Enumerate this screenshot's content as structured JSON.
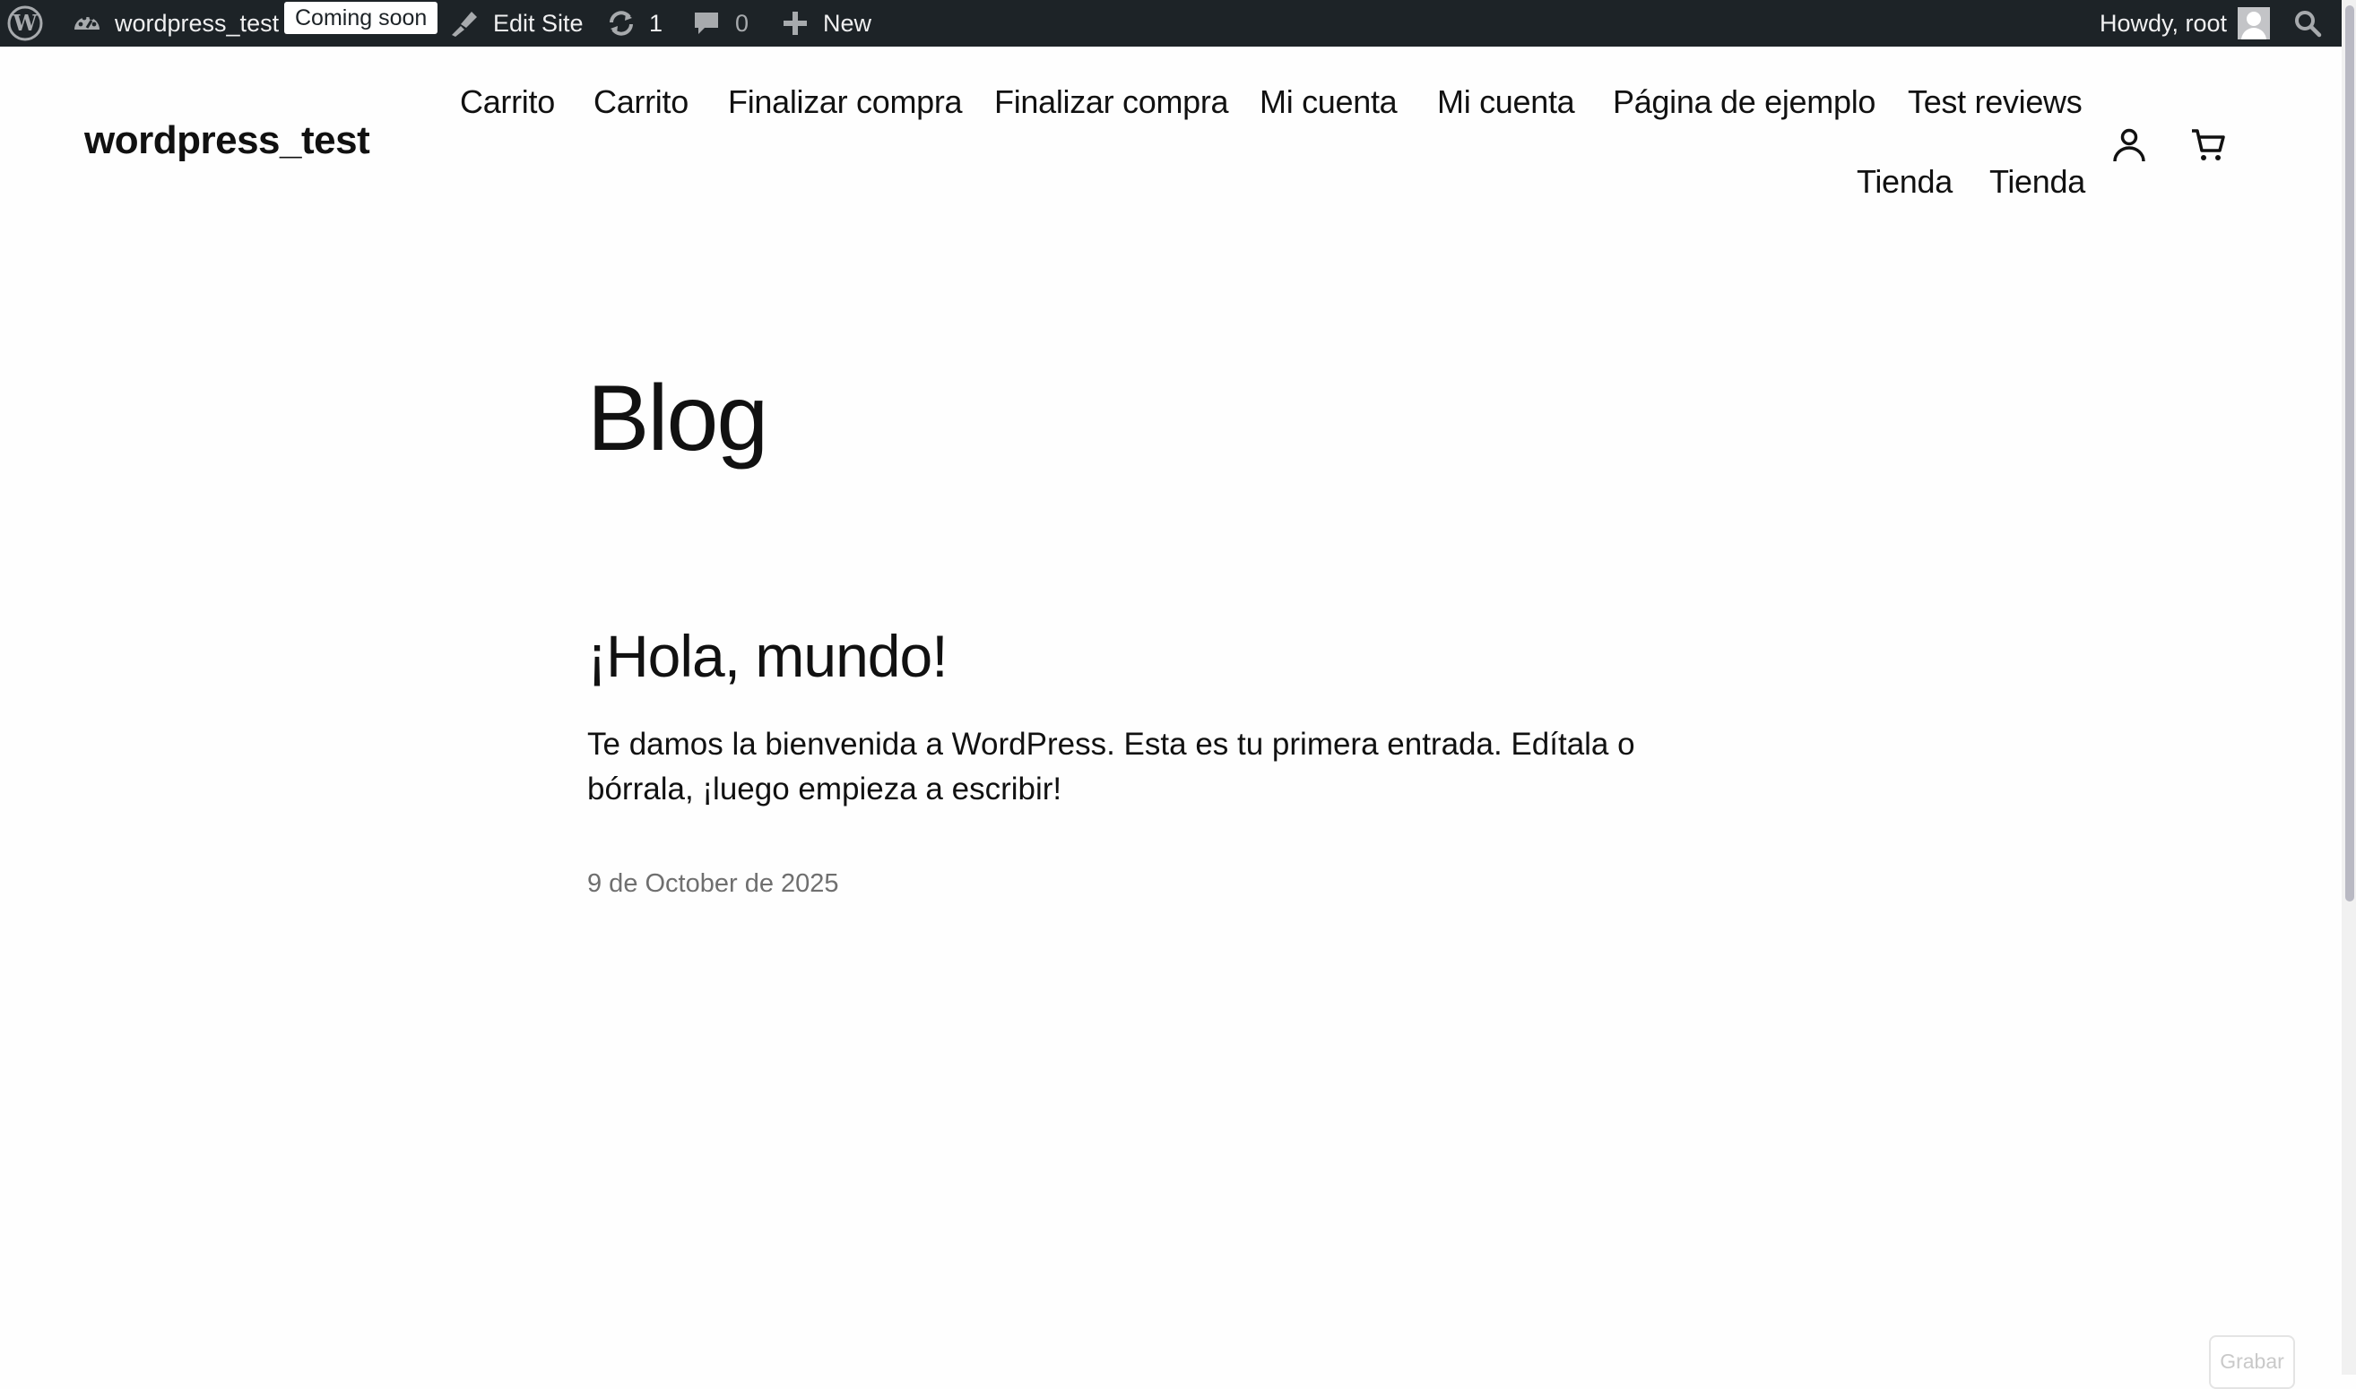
{
  "adminbar": {
    "wp_logo_icon": "wordpress-logo-icon",
    "site_name": "wordpress_test",
    "coming_soon_badge": "Coming soon",
    "edit_site": "Edit Site",
    "updates_count": "1",
    "comments_count": "0",
    "new_label": "New",
    "howdy": "Howdy, root"
  },
  "header": {
    "site_title": "wordpress_test",
    "nav": [
      "Carrito",
      "Carrito",
      "Finalizar compra",
      "Finalizar compra",
      "Mi cuenta",
      "Mi cuenta",
      "Página de ejemplo",
      "Test reviews",
      "Tienda",
      "Tienda"
    ],
    "account_icon": "account-icon",
    "cart_icon": "cart-icon"
  },
  "main": {
    "page_title": "Blog",
    "post": {
      "title": "¡Hola, mundo!",
      "excerpt": "Te damos la bienvenida a WordPress. Esta es tu primera entrada. Edítala o bórrala, ¡luego empieza a escribir!",
      "date": "9 de October de 2025"
    }
  },
  "record_button": "Grabar",
  "colors": {
    "adminbar_bg": "#1d2327",
    "adminbar_text": "#f0f0f1",
    "page_bg": "#fefefe",
    "text": "#111111",
    "date_text": "#6f6f6f"
  }
}
